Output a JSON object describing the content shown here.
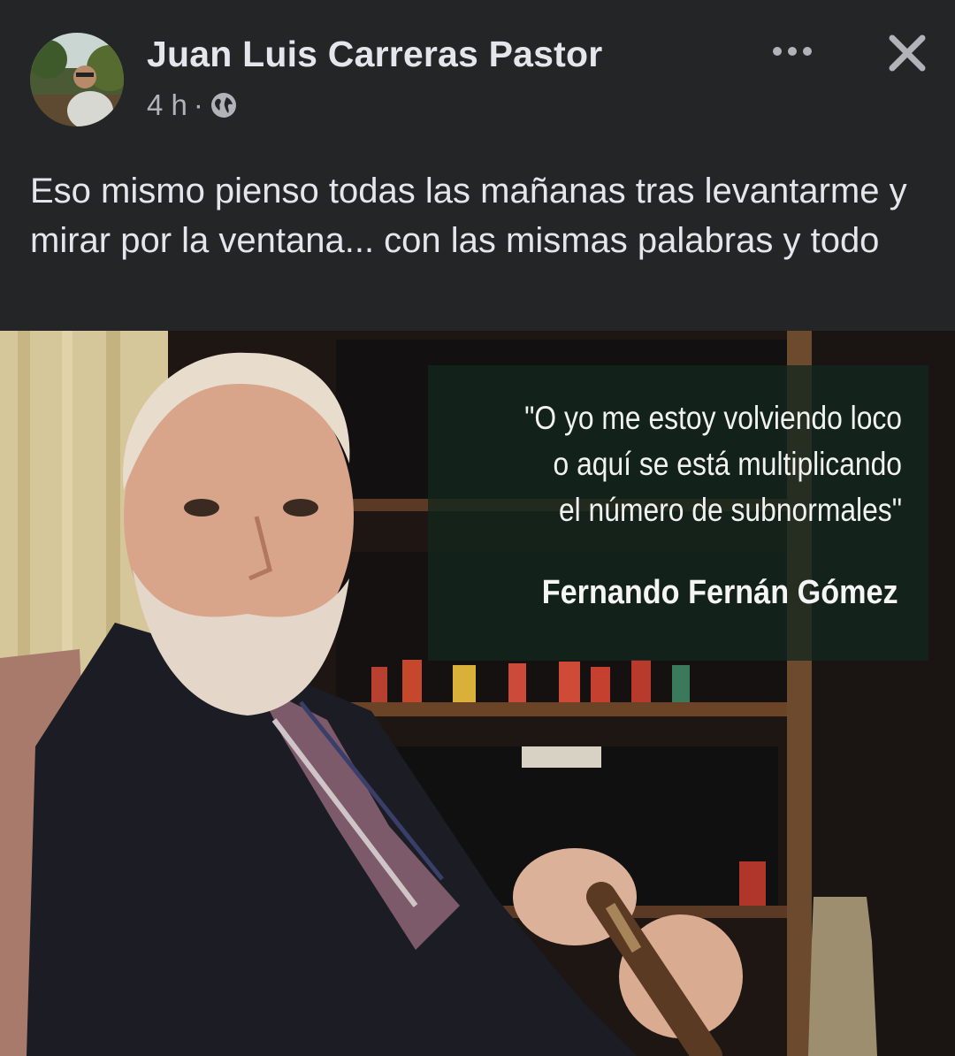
{
  "post": {
    "author_name": "Juan Luis Carreras Pastor",
    "time": "4 h",
    "separator": "·",
    "audience_icon": "globe-icon",
    "more_icon": "more-horizontal-icon",
    "close_icon": "close-icon",
    "caption": "Eso mismo pienso todas las mañanas tras levantarme y mirar por la ventana... con las mismas palabras y todo"
  },
  "image": {
    "quote_lines": "\"O yo me estoy volviendo loco\no aquí se está multiplicando\nel número de subnormales\"",
    "quote_author": "Fernando Fernán Gómez"
  },
  "colors": {
    "background": "#242526",
    "primary_text": "#e4e6eb",
    "secondary_text": "#b0b3b8"
  }
}
